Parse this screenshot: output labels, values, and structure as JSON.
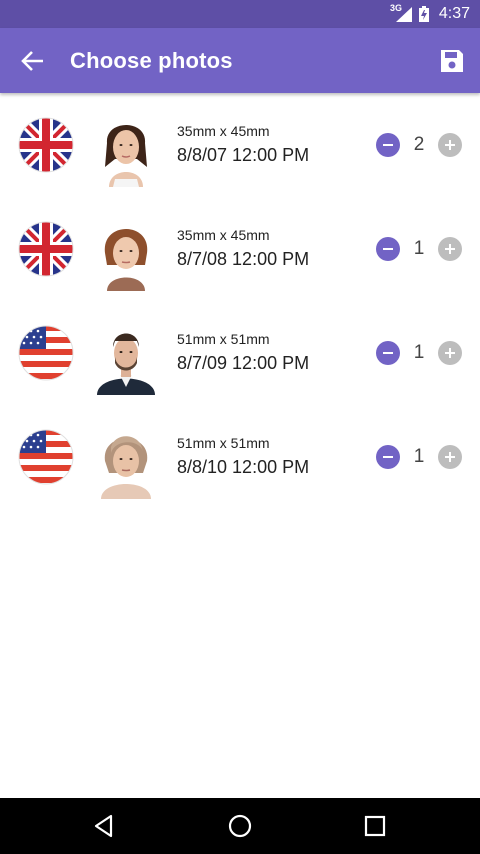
{
  "status_bar": {
    "network": "3G",
    "time": "4:37"
  },
  "app_bar": {
    "title": "Choose photos",
    "back_icon": "arrow-back-icon",
    "save_icon": "save-icon"
  },
  "colors": {
    "primary": "#7263c5",
    "status_bar": "#5e4fa6",
    "disabled": "#bdbdbd"
  },
  "items": [
    {
      "flag": "uk-flag-icon",
      "size": "35mm x 45mm",
      "date": "8/8/07 12:00 PM",
      "count": "2"
    },
    {
      "flag": "uk-flag-icon",
      "size": "35mm x 45mm",
      "date": "8/7/08 12:00 PM",
      "count": "1"
    },
    {
      "flag": "us-flag-icon",
      "size": "51mm x 51mm",
      "date": "8/7/09 12:00 PM",
      "count": "1"
    },
    {
      "flag": "us-flag-icon",
      "size": "51mm x 51mm",
      "date": "8/8/10 12:00 PM",
      "count": "1"
    }
  ],
  "nav_bar": {
    "back_icon": "nav-back-icon",
    "home_icon": "nav-home-icon",
    "recents_icon": "nav-recents-icon"
  }
}
